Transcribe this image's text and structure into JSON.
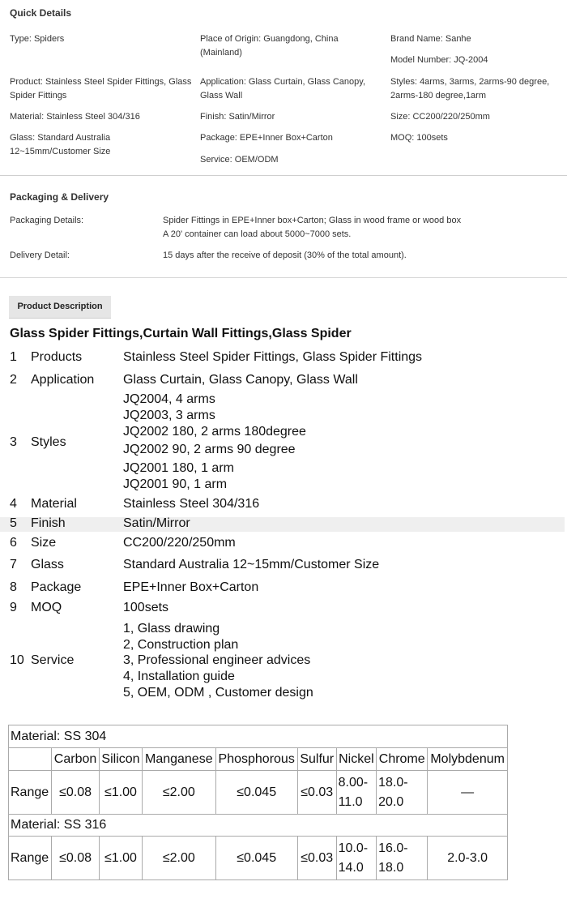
{
  "quick_details": {
    "title": "Quick Details",
    "col1": [
      "Type: Spiders",
      "Product: Stainless Steel Spider Fittings, Glass Spider Fittings",
      "Material: Stainless Steel 304/316",
      "Glass: Standard Australia 12~15mm/Customer Size"
    ],
    "col2": [
      "Place of Origin: Guangdong, China (Mainland)",
      "Application: Glass Curtain, Glass Canopy, Glass Wall",
      "Finish: Satin/Mirror",
      "Package: EPE+Inner Box+Carton",
      "Service: OEM/ODM"
    ],
    "col3": [
      "Brand Name: Sanhe",
      "Model Number: JQ-2004",
      "Styles: 4arms, 3arms, 2arms-90 degree, 2arms-180 degree,1arm",
      "Size: CC200/220/250mm",
      "MOQ: 100sets"
    ]
  },
  "packaging": {
    "title": "Packaging & Delivery",
    "details_label": "Packaging Details:",
    "details_line1": "Spider Fittings in EPE+Inner box+Carton; Glass in wood frame or wood box",
    "details_line2": "A 20' container can load about 5000~7000 sets.",
    "delivery_label": "Delivery Detail:",
    "delivery_value": "15 days after the receive of deposit (30% of the total amount)."
  },
  "tab_label": "Product Description",
  "description": {
    "title": "Glass Spider Fittings,Curtain Wall Fittings,Glass Spider",
    "items": [
      {
        "num": "1",
        "key": "Products",
        "values": [
          "Stainless Steel Spider Fittings, Glass Spider Fittings"
        ]
      },
      {
        "num": "2",
        "key": "Application",
        "values": [
          "Glass Curtain, Glass Canopy, Glass Wall"
        ]
      },
      {
        "num": "3",
        "key": "Styles",
        "values": [
          "JQ2004, 4 arms",
          "JQ2003, 3 arms",
          "JQ2002 180, 2 arms 180degree",
          "JQ2002 90, 2 arms 90 degree",
          "JQ2001 180, 1 arm",
          "JQ2001 90, 1 arm"
        ]
      },
      {
        "num": "4",
        "key": "Material",
        "values": [
          "Stainless Steel 304/316"
        ]
      },
      {
        "num": "5",
        "key": "Finish",
        "values": [
          "Satin/Mirror"
        ]
      },
      {
        "num": "6",
        "key": "Size",
        "values": [
          "CC200/220/250mm"
        ]
      },
      {
        "num": "7",
        "key": "Glass",
        "values": [
          "Standard Australia 12~15mm/Customer Size"
        ]
      },
      {
        "num": "8",
        "key": "Package",
        "values": [
          "EPE+Inner Box+Carton"
        ]
      },
      {
        "num": "9",
        "key": "MOQ",
        "values": [
          "100sets"
        ]
      },
      {
        "num": "10",
        "key": "Service",
        "values": [
          "1,  Glass drawing",
          "2,  Construction plan",
          "3,  Professional engineer advices",
          "4,  Installation guide",
          "5,  OEM, ODM , Customer design"
        ]
      }
    ]
  },
  "chem_table": {
    "headers": [
      "Carbon",
      "Silicon",
      "Manganese",
      "Phosphorous",
      "Sulfur",
      "Nickel",
      "Chrome",
      "Molybdenum"
    ],
    "rows": [
      {
        "material": "Material: SS 304",
        "label": "Range",
        "values": [
          "≤0.08",
          "≤1.00",
          "≤2.00",
          "≤0.045",
          "≤0.03",
          "8.00-\n11.0",
          "18.0-\n20.0",
          "—"
        ]
      },
      {
        "material": "Material: SS 316",
        "label": "Range",
        "values": [
          "≤0.08",
          "≤1.00",
          "≤2.00",
          "≤0.045",
          "≤0.03",
          "10.0-\n14.0",
          "16.0-\n18.0",
          "2.0-3.0"
        ]
      }
    ]
  }
}
